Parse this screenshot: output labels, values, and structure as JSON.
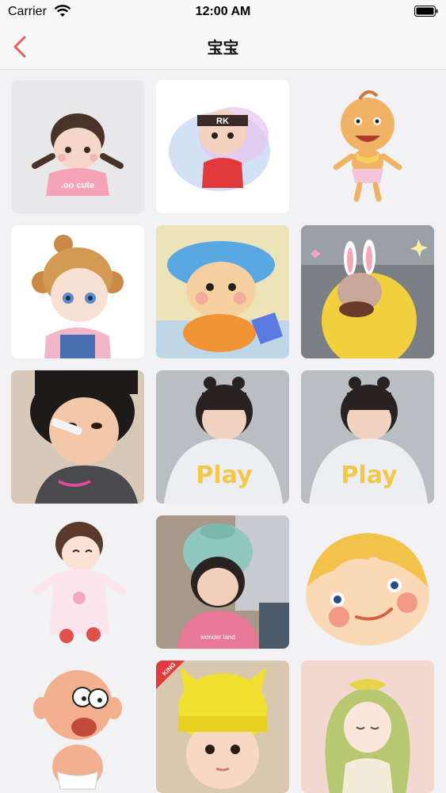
{
  "status_bar": {
    "carrier": "Carrier",
    "time": "12:00 AM"
  },
  "nav": {
    "title": "宝宝"
  },
  "grid": {
    "items": [
      {
        "name": "cartoon-girl-pigtails-cute-shirt"
      },
      {
        "name": "cartoon-boy-headband-watercolor"
      },
      {
        "name": "cartoon-baby-diaper-bib"
      },
      {
        "name": "cartoon-curly-hair-girl"
      },
      {
        "name": "cartoon-baby-blue-hat"
      },
      {
        "name": "teletubby-baby-photo"
      },
      {
        "name": "girl-eating-spoon-photo"
      },
      {
        "name": "girl-play-shirt-photo"
      },
      {
        "name": "girl-play-shirt-photo-2"
      },
      {
        "name": "cartoon-girl-pink-pajamas"
      },
      {
        "name": "girl-knit-hat-photo"
      },
      {
        "name": "cartoon-boy-face-yellow-hair"
      },
      {
        "name": "cartoon-bald-baby-diaper"
      },
      {
        "name": "baby-yellow-hat-photo"
      },
      {
        "name": "anime-girl-green-hair"
      }
    ]
  }
}
